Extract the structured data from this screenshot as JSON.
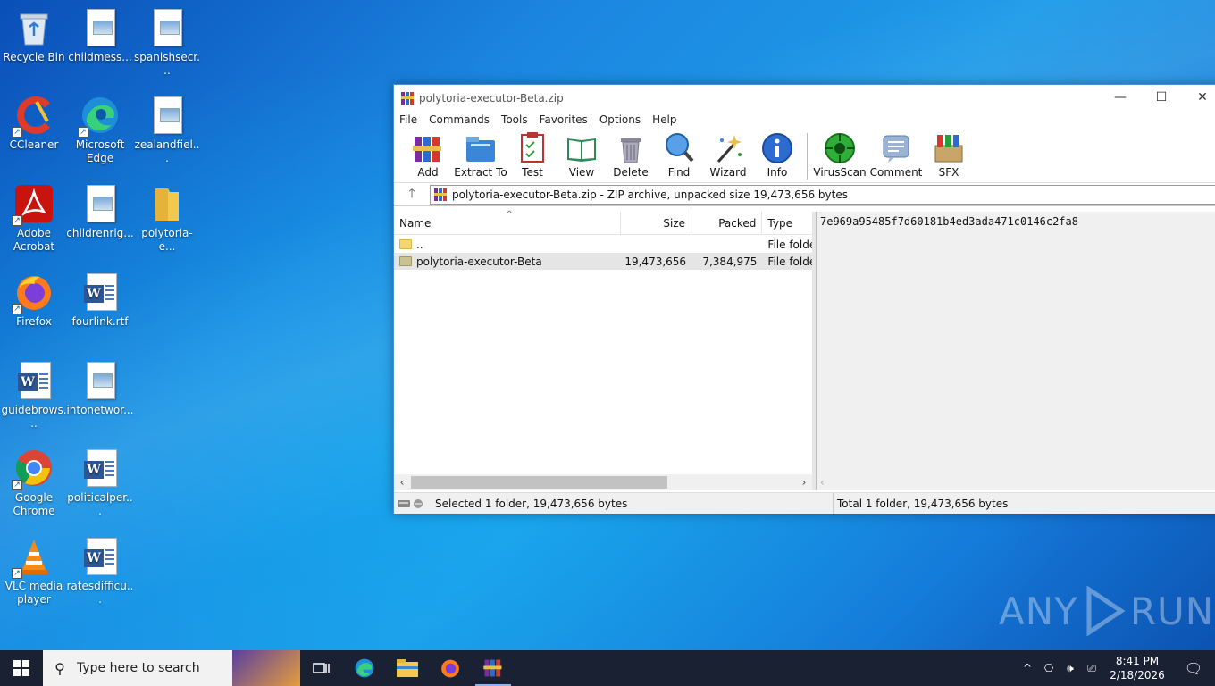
{
  "desktop": {
    "icons": [
      {
        "label": "Recycle Bin"
      },
      {
        "label": "childmess..."
      },
      {
        "label": "spanishsecr..."
      },
      {
        "label": "CCleaner"
      },
      {
        "label": "Microsoft Edge"
      },
      {
        "label": "zealandfiel..."
      },
      {
        "label": "Adobe Acrobat"
      },
      {
        "label": "childrenrig..."
      },
      {
        "label": "polytoria-e..."
      },
      {
        "label": "Firefox"
      },
      {
        "label": "fourlink.rtf"
      },
      {
        "label": "guidebrows..."
      },
      {
        "label": "intonetwor..."
      },
      {
        "label": "Google Chrome"
      },
      {
        "label": "politicalper..."
      },
      {
        "label": "VLC media player"
      },
      {
        "label": "ratesdifficu..."
      }
    ]
  },
  "window": {
    "title": "polytoria-executor-Beta.zip",
    "menu": [
      "File",
      "Commands",
      "Tools",
      "Favorites",
      "Options",
      "Help"
    ],
    "toolbar": [
      {
        "label": "Add",
        "icon": "add-icon"
      },
      {
        "label": "Extract To",
        "icon": "extract-icon"
      },
      {
        "label": "Test",
        "icon": "test-icon"
      },
      {
        "label": "View",
        "icon": "view-icon"
      },
      {
        "label": "Delete",
        "icon": "delete-icon"
      },
      {
        "label": "Find",
        "icon": "find-icon"
      },
      {
        "label": "Wizard",
        "icon": "wizard-icon"
      },
      {
        "label": "Info",
        "icon": "info-icon"
      },
      {
        "label": "VirusScan",
        "icon": "virusscan-icon"
      },
      {
        "label": "Comment",
        "icon": "comment-icon"
      },
      {
        "label": "SFX",
        "icon": "sfx-icon"
      }
    ],
    "address": "polytoria-executor-Beta.zip - ZIP archive, unpacked size 19,473,656 bytes",
    "columns": {
      "name": "Name",
      "size": "Size",
      "packed": "Packed",
      "type": "Type"
    },
    "files": [
      {
        "name": "..",
        "size": "",
        "packed": "",
        "type": "File folde"
      },
      {
        "name": "polytoria-executor-Beta",
        "size": "19,473,656",
        "packed": "7,384,975",
        "type": "File folde"
      }
    ],
    "comment": "7e969a95485f7d60181b4ed3ada471c0146c2fa8",
    "status_left": "Selected 1 folder, 19,473,656 bytes",
    "status_right": "Total 1 folder, 19,473,656 bytes"
  },
  "taskbar": {
    "search_placeholder": "Type here to search",
    "time": "8:41 PM",
    "date": "2/18/2026"
  },
  "watermark": {
    "left": "ANY",
    "right": "RUN"
  }
}
